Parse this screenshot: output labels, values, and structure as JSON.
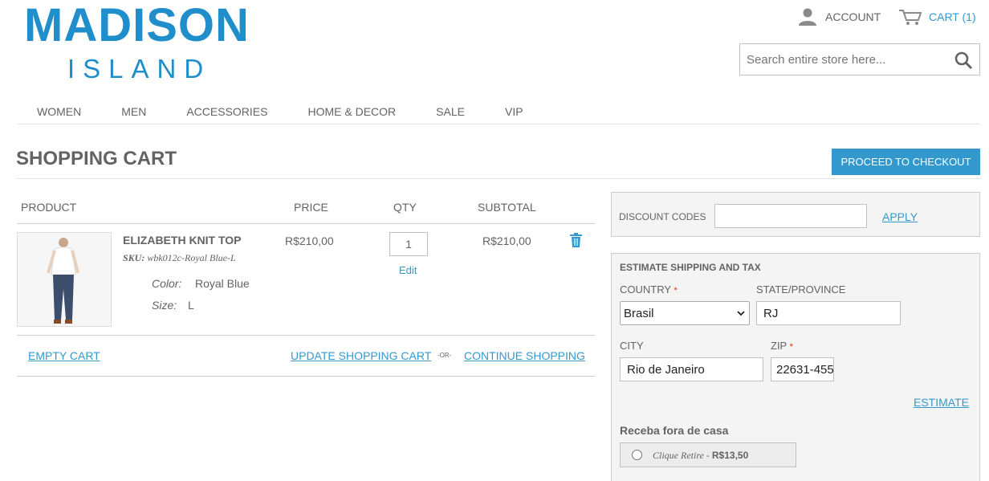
{
  "brand": {
    "line1": "MADISON",
    "line2": "ISLAND",
    "color": "#1f8ecb"
  },
  "header": {
    "account_label": "ACCOUNT",
    "account_icon": "user-icon",
    "cart_label": "CART (1)",
    "cart_icon": "cart-icon",
    "search_placeholder": "Search entire store here...",
    "search_icon": "search-icon"
  },
  "nav": [
    "WOMEN",
    "MEN",
    "ACCESSORIES",
    "HOME & DECOR",
    "SALE",
    "VIP"
  ],
  "page": {
    "title": "SHOPPING CART",
    "checkout_label": "PROCEED TO CHECKOUT",
    "accent": "#3399cc"
  },
  "cart": {
    "headers": {
      "product": "PRODUCT",
      "price": "PRICE",
      "qty": "QTY",
      "subtotal": "SUBTOTAL"
    },
    "items": [
      {
        "name": "ELIZABETH KNIT TOP",
        "sku_label": "SKU:",
        "sku": "wbk012c-Royal Blue-L",
        "options": [
          {
            "label": "Color:",
            "value": "Royal Blue"
          },
          {
            "label": "Size:",
            "value": "L"
          }
        ],
        "price": "R$210,00",
        "qty": "1",
        "edit_label": "Edit",
        "subtotal": "R$210,00",
        "remove_icon": "trash-icon"
      }
    ],
    "empty_label": "EMPTY CART",
    "update_label": "UPDATE SHOPPING CART",
    "or_label": "-OR-",
    "continue_label": "CONTINUE SHOPPING"
  },
  "discount": {
    "label": "DISCOUNT CODES",
    "value": "",
    "apply_label": "APPLY"
  },
  "shipping": {
    "title": "ESTIMATE SHIPPING AND TAX",
    "country_label": "COUNTRY",
    "country_value": "Brasil",
    "state_label": "STATE/PROVINCE",
    "state_value": "RJ",
    "city_label": "CITY",
    "city_value": "Rio de Janeiro",
    "zip_label": "ZIP",
    "zip_value": "22631-455",
    "required_mark": "*",
    "estimate_label": "ESTIMATE",
    "method_group": "Receba fora de casa",
    "method_name": "Clique Retire -",
    "method_price": "R$13,50"
  }
}
